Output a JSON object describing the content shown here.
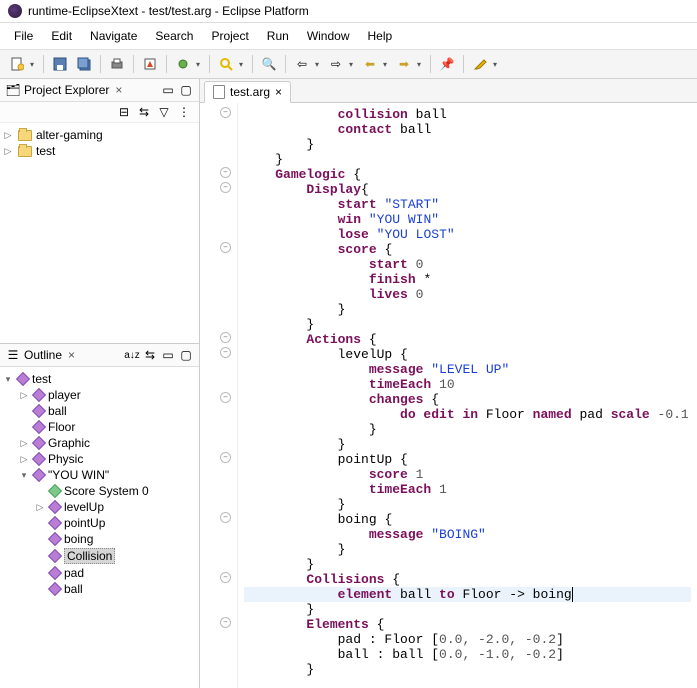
{
  "window": {
    "title": "runtime-EclipseXtext - test/test.arg - Eclipse Platform"
  },
  "menu": {
    "file": "File",
    "edit": "Edit",
    "navigate": "Navigate",
    "search": "Search",
    "project": "Project",
    "run": "Run",
    "window": "Window",
    "help": "Help"
  },
  "explorer": {
    "title": "Project Explorer",
    "items": [
      {
        "label": "alter-gaming",
        "expanded": false
      },
      {
        "label": "test",
        "expanded": false
      }
    ]
  },
  "outline": {
    "title": "Outline",
    "root": "test",
    "items": [
      "player",
      "ball",
      "Floor",
      "Graphic",
      "Physic"
    ],
    "youwin": "\"YOU WIN\"",
    "youwin_children": [
      "Score System 0",
      "levelUp",
      "pointUp",
      "boing",
      "Collision",
      "pad",
      "ball"
    ],
    "selected": "Collision"
  },
  "editor": {
    "tab": "test.arg"
  },
  "code": {
    "l01_a": "collision",
    "l01_b": " ball",
    "l02_a": "contact",
    "l02_b": " ball",
    "l03": "        }",
    "l04": "    }",
    "l05_a": "Gamelogic",
    "l05_b": " {",
    "l06_a": "Display",
    "l06_b": "{",
    "l07_a": "start",
    "l07_b": " ",
    "l07_c": "\"START\"",
    "l08_a": "win",
    "l08_b": " ",
    "l08_c": "\"YOU WIN\"",
    "l09_a": "lose",
    "l09_b": " ",
    "l09_c": "\"YOU LOST\"",
    "l10_a": "score",
    "l10_b": " {",
    "l11_a": "start",
    "l11_b": " ",
    "l11_c": "0",
    "l12_a": "finish",
    "l12_b": " *",
    "l13_a": "lives",
    "l13_b": " ",
    "l13_c": "0",
    "l14": "            }",
    "l15": "        }",
    "l16_a": "Actions",
    "l16_b": " {",
    "l17_a": "levelUp",
    "l17_b": " {",
    "l18_a": "message",
    "l18_b": " ",
    "l18_c": "\"LEVEL UP\"",
    "l19_a": "timeEach",
    "l19_b": " ",
    "l19_c": "10",
    "l20_a": "changes",
    "l20_b": " {",
    "l21_a": "do edit in",
    "l21_b": " Floor ",
    "l21_c": "named",
    "l21_d": " pad ",
    "l21_e": "scale",
    "l21_f": " ",
    "l21_g": "-0.1",
    "l22": "                }",
    "l23": "            }",
    "l24_a": "pointUp",
    "l24_b": " {",
    "l25_a": "score",
    "l25_b": " ",
    "l25_c": "1",
    "l26_a": "timeEach",
    "l26_b": " ",
    "l26_c": "1",
    "l27": "            }",
    "l28_a": "boing",
    "l28_b": " {",
    "l29_a": "message",
    "l29_b": " ",
    "l29_c": "\"BOING\"",
    "l30": "            }",
    "l31": "        }",
    "l32_a": "Collisions",
    "l32_b": " {",
    "l33_a": "element",
    "l33_b": " ball ",
    "l33_c": "to",
    "l33_d": " Floor -> boing",
    "l34": "        }",
    "l35_a": "Elements",
    "l35_b": " {",
    "l36": "            pad : Floor [",
    "l36_n": "0.0, -2.0, -0.2",
    "l36_e": "]",
    "l37": "            ball : ball [",
    "l37_n": "0.0, -1.0, -0.2",
    "l37_e": "]",
    "l38": "        }"
  }
}
